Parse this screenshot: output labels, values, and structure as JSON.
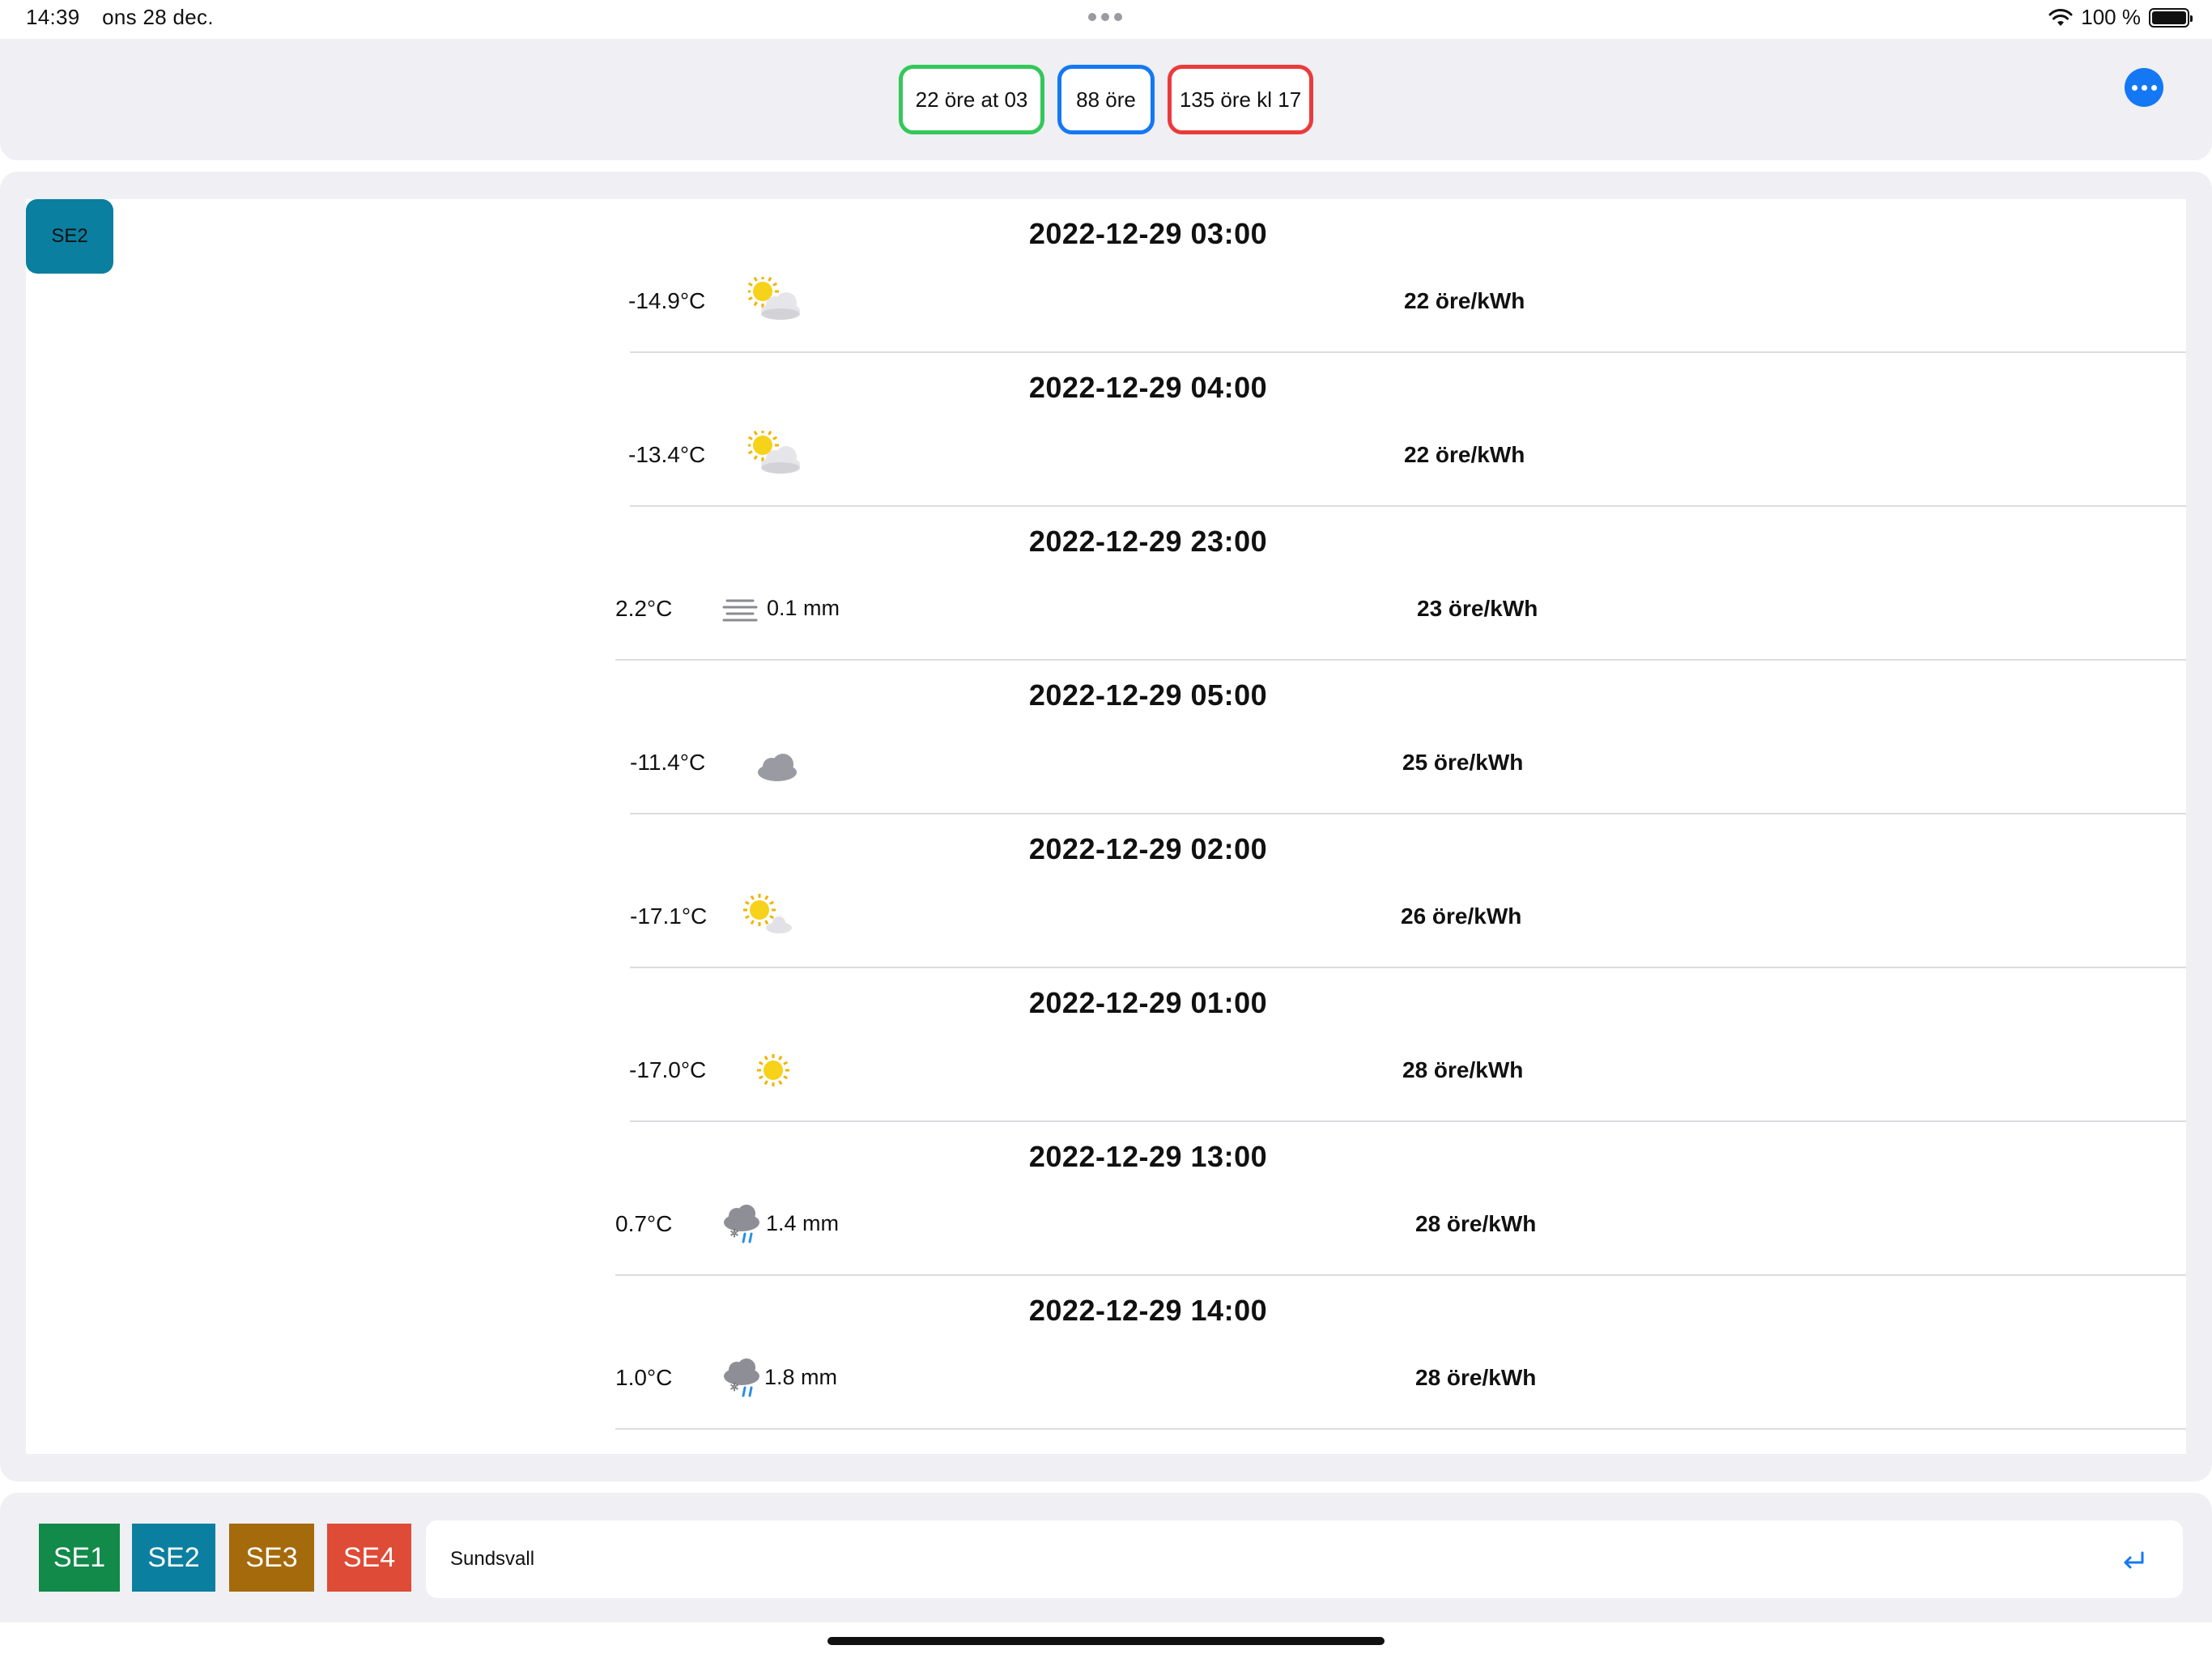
{
  "status_bar": {
    "time": "14:39",
    "date": "ons 28 dec.",
    "battery_text": "100 %",
    "icons": [
      "wifi-icon",
      "battery-icon"
    ]
  },
  "header": {
    "low_price": "22 öre at 03",
    "avg_price": "88 öre",
    "high_price": "135 öre kl 17",
    "colors": {
      "low": "#34c759",
      "avg": "#1478f5",
      "high": "#ea3b3b"
    }
  },
  "main": {
    "zone_badge": "SE2",
    "entries": [
      {
        "time": "2022-12-29 03:00",
        "temp": "-14.9°C",
        "icon": "sun-behind-cloud-icon",
        "precip": "",
        "price": "22 öre/kWh"
      },
      {
        "time": "2022-12-29 04:00",
        "temp": "-13.4°C",
        "icon": "sun-behind-cloud-icon",
        "precip": "",
        "price": "22 öre/kWh"
      },
      {
        "time": "2022-12-29 23:00",
        "temp": "2.2°C",
        "icon": "fog-icon",
        "precip": "0.1 mm",
        "price": "23 öre/kWh"
      },
      {
        "time": "2022-12-29 05:00",
        "temp": "-11.4°C",
        "icon": "cloud-icon",
        "precip": "",
        "price": "25 öre/kWh"
      },
      {
        "time": "2022-12-29 02:00",
        "temp": "-17.1°C",
        "icon": "sun-small-cloud-icon",
        "precip": "",
        "price": "26 öre/kWh"
      },
      {
        "time": "2022-12-29 01:00",
        "temp": "-17.0°C",
        "icon": "sun-icon",
        "precip": "",
        "price": "28 öre/kWh"
      },
      {
        "time": "2022-12-29 13:00",
        "temp": "0.7°C",
        "icon": "sleet-icon",
        "precip": "1.4 mm",
        "price": "28 öre/kWh"
      },
      {
        "time": "2022-12-29 14:00",
        "temp": "1.0°C",
        "icon": "sleet-icon",
        "precip": "1.8 mm",
        "price": "28 öre/kWh"
      }
    ]
  },
  "bottom": {
    "zones": [
      "SE1",
      "SE2",
      "SE3",
      "SE4"
    ],
    "zone_colors": [
      "#118a4a",
      "#0b7fa0",
      "#a56a0c",
      "#de4b36"
    ],
    "city_value": "Sundsvall"
  }
}
